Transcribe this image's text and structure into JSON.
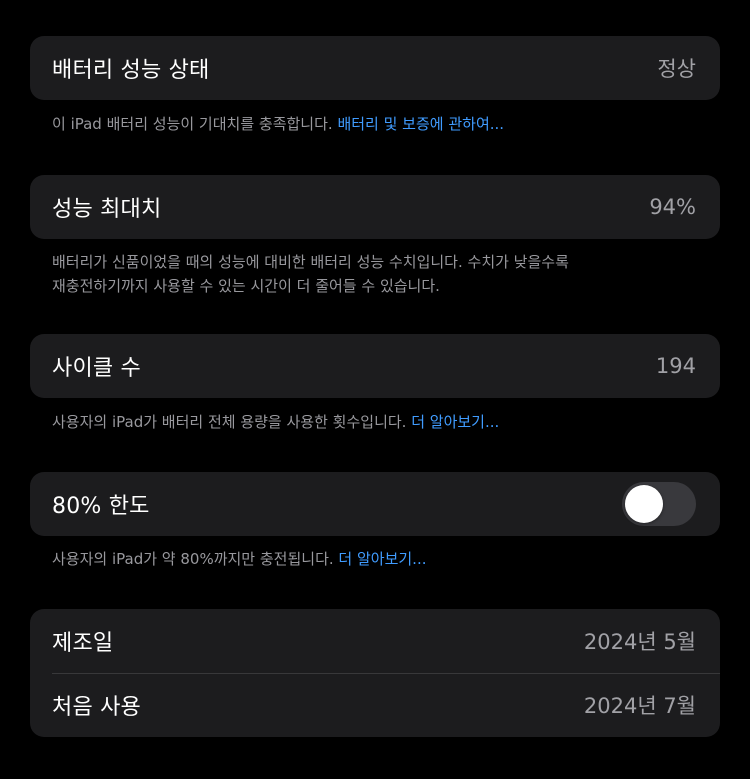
{
  "battery_health": {
    "label": "배터리 성능 상태",
    "value": "정상",
    "note": "이 iPad 배터리 성능이 기대치를 충족합니다. ",
    "note_link": "배터리 및 보증에 관하여..."
  },
  "max_capacity": {
    "label": "성능 최대치",
    "value": "94%",
    "note_line1": "배터리가 신품이었을 때의 성능에 대비한 배터리 성능 수치입니다. 수치가 낮을수록",
    "note_line2": "재충전하기까지 사용할 수 있는 시간이 더 줄어들 수 있습니다."
  },
  "cycle_count": {
    "label": "사이클 수",
    "value": "194",
    "note": "사용자의 iPad가 배터리 전체 용량을 사용한 횟수입니다. ",
    "note_link": "더 알아보기..."
  },
  "limit_80": {
    "label": "80% 한도",
    "toggle_on": false,
    "note": "사용자의 iPad가 약 80%까지만 충전됩니다. ",
    "note_link": "더 알아보기..."
  },
  "dates": {
    "manufacture_label": "제조일",
    "manufacture_value": "2024년 5월",
    "first_use_label": "처음 사용",
    "first_use_value": "2024년 7월"
  },
  "colors": {
    "background": "#000000",
    "card": "#1c1c1e",
    "link": "#409cff",
    "secondary_text": "#98989d"
  }
}
